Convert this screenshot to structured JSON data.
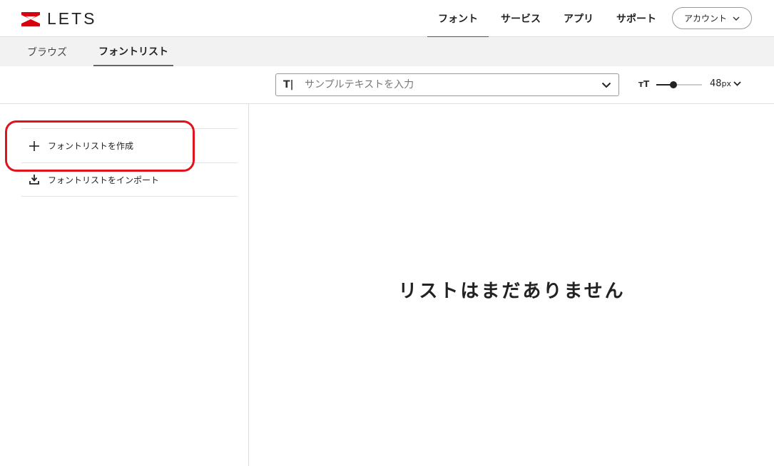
{
  "header": {
    "logo_text": "LETS",
    "nav": [
      {
        "label": "フォント",
        "active": true
      },
      {
        "label": "サービス"
      },
      {
        "label": "アプリ"
      },
      {
        "label": "サポート"
      }
    ],
    "account_label": "アカウント"
  },
  "subnav": {
    "tabs": [
      {
        "label": "ブラウズ"
      },
      {
        "label": "フォントリスト",
        "active": true
      }
    ]
  },
  "toolbar": {
    "sample_placeholder": "サンプルテキストを入力",
    "font_size": "48",
    "font_size_unit": "px",
    "slider_fraction": 0.38
  },
  "sidebar": {
    "create_label": "フォントリストを作成",
    "import_label": "フォントリストをインポート"
  },
  "main": {
    "empty_message": "リストはまだありません"
  },
  "colors": {
    "brand_red": "#d7000f",
    "highlight": "#e0141e"
  }
}
